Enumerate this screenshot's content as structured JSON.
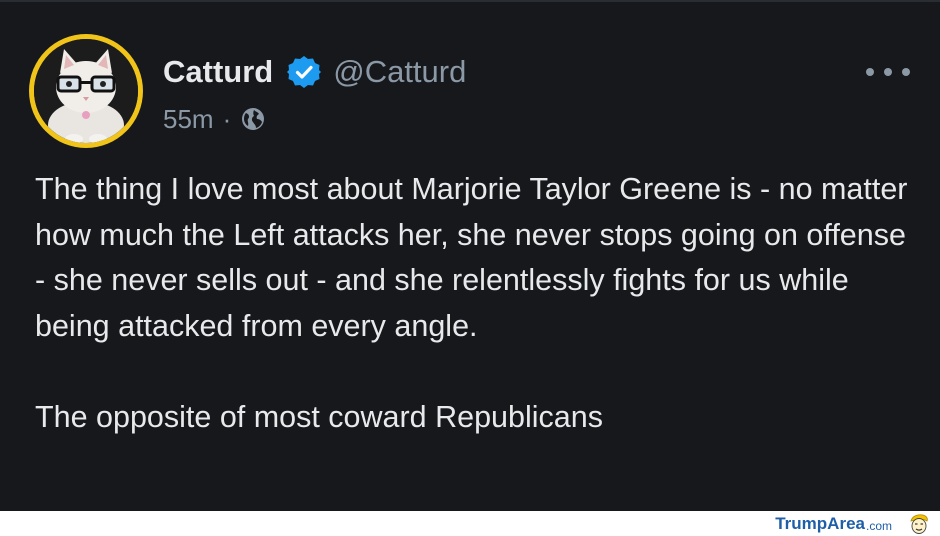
{
  "tweet": {
    "display_name": "Catturd",
    "handle": "@Catturd",
    "timestamp": "55m",
    "separator": "·",
    "visibility_icon": "globe-icon",
    "verified_icon": "verified-badge-icon",
    "more_icon": "more-options-icon",
    "paragraphs": [
      "The thing I love most about Marjorie Taylor Greene is - no matter how much the Left attacks her, she never stops going on offense - she never sells out - and she relentlessly fights for us while being attacked from every angle.",
      "The opposite of most coward Republicans"
    ]
  },
  "watermark": {
    "part1": "Trump",
    "part2": "Area",
    "part3": ".com",
    "logo_icon": "trump-face-logo-icon"
  },
  "colors": {
    "card_background": "#16181c",
    "text_primary": "#e7e9ea",
    "text_secondary": "#8b98a5",
    "verified_blue": "#1d9bf0",
    "avatar_ring": "#f0c419",
    "watermark_blue": "#1f5fa8"
  }
}
